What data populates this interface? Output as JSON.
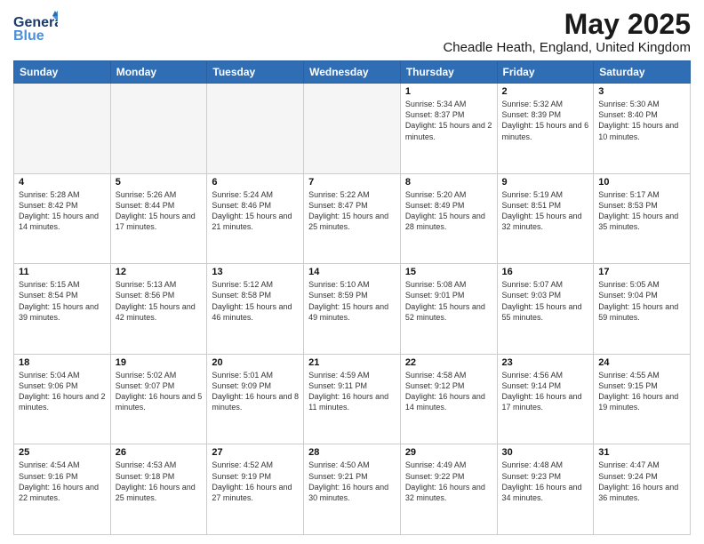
{
  "header": {
    "logo_general": "General",
    "logo_blue": "Blue",
    "month_title": "May 2025",
    "location": "Cheadle Heath, England, United Kingdom"
  },
  "days_of_week": [
    "Sunday",
    "Monday",
    "Tuesday",
    "Wednesday",
    "Thursday",
    "Friday",
    "Saturday"
  ],
  "weeks": [
    [
      {
        "day": "",
        "empty": true
      },
      {
        "day": "",
        "empty": true
      },
      {
        "day": "",
        "empty": true
      },
      {
        "day": "",
        "empty": true
      },
      {
        "day": "1",
        "sunrise": "5:34 AM",
        "sunset": "8:37 PM",
        "daylight": "15 hours and 2 minutes."
      },
      {
        "day": "2",
        "sunrise": "5:32 AM",
        "sunset": "8:39 PM",
        "daylight": "15 hours and 6 minutes."
      },
      {
        "day": "3",
        "sunrise": "5:30 AM",
        "sunset": "8:40 PM",
        "daylight": "15 hours and 10 minutes."
      }
    ],
    [
      {
        "day": "4",
        "sunrise": "5:28 AM",
        "sunset": "8:42 PM",
        "daylight": "15 hours and 14 minutes."
      },
      {
        "day": "5",
        "sunrise": "5:26 AM",
        "sunset": "8:44 PM",
        "daylight": "15 hours and 17 minutes."
      },
      {
        "day": "6",
        "sunrise": "5:24 AM",
        "sunset": "8:46 PM",
        "daylight": "15 hours and 21 minutes."
      },
      {
        "day": "7",
        "sunrise": "5:22 AM",
        "sunset": "8:47 PM",
        "daylight": "15 hours and 25 minutes."
      },
      {
        "day": "8",
        "sunrise": "5:20 AM",
        "sunset": "8:49 PM",
        "daylight": "15 hours and 28 minutes."
      },
      {
        "day": "9",
        "sunrise": "5:19 AM",
        "sunset": "8:51 PM",
        "daylight": "15 hours and 32 minutes."
      },
      {
        "day": "10",
        "sunrise": "5:17 AM",
        "sunset": "8:53 PM",
        "daylight": "15 hours and 35 minutes."
      }
    ],
    [
      {
        "day": "11",
        "sunrise": "5:15 AM",
        "sunset": "8:54 PM",
        "daylight": "15 hours and 39 minutes."
      },
      {
        "day": "12",
        "sunrise": "5:13 AM",
        "sunset": "8:56 PM",
        "daylight": "15 hours and 42 minutes."
      },
      {
        "day": "13",
        "sunrise": "5:12 AM",
        "sunset": "8:58 PM",
        "daylight": "15 hours and 46 minutes."
      },
      {
        "day": "14",
        "sunrise": "5:10 AM",
        "sunset": "8:59 PM",
        "daylight": "15 hours and 49 minutes."
      },
      {
        "day": "15",
        "sunrise": "5:08 AM",
        "sunset": "9:01 PM",
        "daylight": "15 hours and 52 minutes."
      },
      {
        "day": "16",
        "sunrise": "5:07 AM",
        "sunset": "9:03 PM",
        "daylight": "15 hours and 55 minutes."
      },
      {
        "day": "17",
        "sunrise": "5:05 AM",
        "sunset": "9:04 PM",
        "daylight": "15 hours and 59 minutes."
      }
    ],
    [
      {
        "day": "18",
        "sunrise": "5:04 AM",
        "sunset": "9:06 PM",
        "daylight": "16 hours and 2 minutes."
      },
      {
        "day": "19",
        "sunrise": "5:02 AM",
        "sunset": "9:07 PM",
        "daylight": "16 hours and 5 minutes."
      },
      {
        "day": "20",
        "sunrise": "5:01 AM",
        "sunset": "9:09 PM",
        "daylight": "16 hours and 8 minutes."
      },
      {
        "day": "21",
        "sunrise": "4:59 AM",
        "sunset": "9:11 PM",
        "daylight": "16 hours and 11 minutes."
      },
      {
        "day": "22",
        "sunrise": "4:58 AM",
        "sunset": "9:12 PM",
        "daylight": "16 hours and 14 minutes."
      },
      {
        "day": "23",
        "sunrise": "4:56 AM",
        "sunset": "9:14 PM",
        "daylight": "16 hours and 17 minutes."
      },
      {
        "day": "24",
        "sunrise": "4:55 AM",
        "sunset": "9:15 PM",
        "daylight": "16 hours and 19 minutes."
      }
    ],
    [
      {
        "day": "25",
        "sunrise": "4:54 AM",
        "sunset": "9:16 PM",
        "daylight": "16 hours and 22 minutes."
      },
      {
        "day": "26",
        "sunrise": "4:53 AM",
        "sunset": "9:18 PM",
        "daylight": "16 hours and 25 minutes."
      },
      {
        "day": "27",
        "sunrise": "4:52 AM",
        "sunset": "9:19 PM",
        "daylight": "16 hours and 27 minutes."
      },
      {
        "day": "28",
        "sunrise": "4:50 AM",
        "sunset": "9:21 PM",
        "daylight": "16 hours and 30 minutes."
      },
      {
        "day": "29",
        "sunrise": "4:49 AM",
        "sunset": "9:22 PM",
        "daylight": "16 hours and 32 minutes."
      },
      {
        "day": "30",
        "sunrise": "4:48 AM",
        "sunset": "9:23 PM",
        "daylight": "16 hours and 34 minutes."
      },
      {
        "day": "31",
        "sunrise": "4:47 AM",
        "sunset": "9:24 PM",
        "daylight": "16 hours and 36 minutes."
      }
    ]
  ]
}
